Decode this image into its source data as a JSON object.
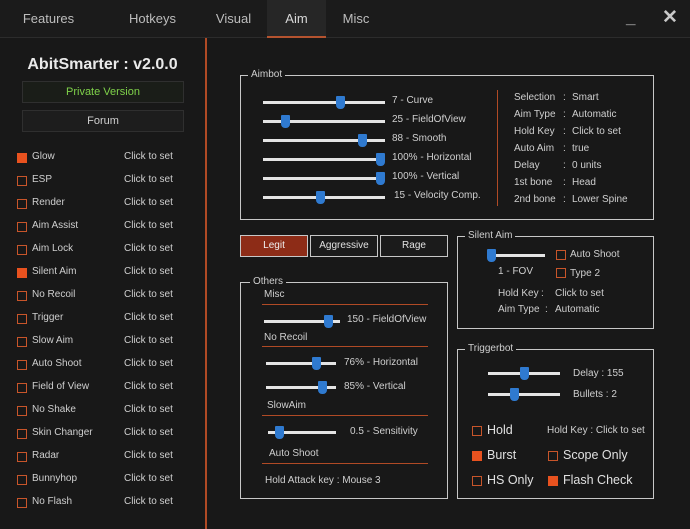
{
  "tabs": [
    "Features",
    "Hotkeys",
    "Visual",
    "Aim",
    "Misc"
  ],
  "window": {
    "minimize": "_",
    "close": "✕"
  },
  "app": {
    "title": "AbitSmarter : v2.0.0",
    "private_label": "Private Version",
    "forum_label": "Forum"
  },
  "features": [
    {
      "label": "Glow",
      "value": "Click to set",
      "checked": true
    },
    {
      "label": "ESP",
      "value": "Click to set",
      "checked": false
    },
    {
      "label": "Render",
      "value": "Click to set",
      "checked": false
    },
    {
      "label": "Aim Assist",
      "value": "Click to set",
      "checked": false
    },
    {
      "label": "Aim Lock",
      "value": "Click to set",
      "checked": false
    },
    {
      "label": "Silent Aim",
      "value": "Click to set",
      "checked": true
    },
    {
      "label": "No Recoil",
      "value": "Click to set",
      "checked": false
    },
    {
      "label": "Trigger",
      "value": "Click to set",
      "checked": false
    },
    {
      "label": "Slow Aim",
      "value": "Click to set",
      "checked": false
    },
    {
      "label": "Auto Shoot",
      "value": "Click to set",
      "checked": false
    },
    {
      "label": "Field of View",
      "value": "Click to set",
      "checked": false
    },
    {
      "label": "No Shake",
      "value": "Click to set",
      "checked": false
    },
    {
      "label": "Skin Changer",
      "value": "Click to set",
      "checked": false
    },
    {
      "label": "Radar",
      "value": "Click to set",
      "checked": false
    },
    {
      "label": "Bunnyhop",
      "value": "Click to set",
      "checked": false
    },
    {
      "label": "No Flash",
      "value": "Click to set",
      "checked": false
    }
  ],
  "aimbot": {
    "title": "Aimbot",
    "sliders": [
      {
        "label": "7 - Curve",
        "level": 0.65
      },
      {
        "label": "25 - FieldOfView",
        "level": 0.16
      },
      {
        "label": "88 - Smooth",
        "level": 0.84
      },
      {
        "label": "100% - Horizontal",
        "level": 1.0
      },
      {
        "label": "100% - Vertical",
        "level": 1.0
      },
      {
        "label": "15 - Velocity Comp.",
        "level": 0.47
      }
    ],
    "info": [
      {
        "key": "Selection",
        "value": "Smart"
      },
      {
        "key": "Aim Type",
        "value": "Automatic"
      },
      {
        "key": "Hold Key",
        "value": "Click to set"
      },
      {
        "key": "Auto Aim",
        "value": "true"
      },
      {
        "key": "Delay",
        "value": "0 units"
      },
      {
        "key": "1st bone",
        "value": "Head"
      },
      {
        "key": "2nd bone",
        "value": "Lower Spine"
      }
    ]
  },
  "modes": {
    "legit": "Legit",
    "aggressive": "Aggressive",
    "rage": "Rage",
    "active": "Legit"
  },
  "others": {
    "title": "Others",
    "misc_label": "Misc",
    "fov_slider": {
      "label": "150 - FieldOfView",
      "level": 0.9
    },
    "no_recoil_label": "No Recoil",
    "horizontal_slider": {
      "label": "76% - Horizontal",
      "level": 0.76
    },
    "vertical_slider": {
      "label": "85% - Vertical",
      "level": 0.85
    },
    "slow_aim_label": "SlowAim",
    "sensitivity_slider": {
      "label": "0.5 - Sensitivity",
      "level": 0.12
    },
    "auto_shoot_label": "Auto Shoot",
    "hold_attack": "Hold Attack key : Mouse 3"
  },
  "silent_aim": {
    "title": "Silent Aim",
    "fov_label": "1 - FOV",
    "fov_level": 0.0,
    "auto_shoot": "Auto Shoot",
    "type2": "Type 2",
    "hold_key_label": "Hold Key",
    "hold_key_value": "Click to set",
    "aim_type_label": "Aim Type",
    "aim_type_value": "Automatic"
  },
  "triggerbot": {
    "title": "Triggerbot",
    "delay_label": "Delay : 155",
    "delay_level": 0.5,
    "bullets_label": "Bullets : 2",
    "bullets_level": 0.35,
    "hold": "Hold",
    "hold_key": "Hold Key : Click to set",
    "burst": "Burst",
    "scope_only": "Scope Only",
    "hs_only": "HS Only",
    "flash_check": "Flash Check"
  },
  "colors": {
    "accent": "#e8521f",
    "divider": "#b04a25",
    "slider_thumb": "#2f7ad0",
    "private_green": "#7fd24a"
  }
}
